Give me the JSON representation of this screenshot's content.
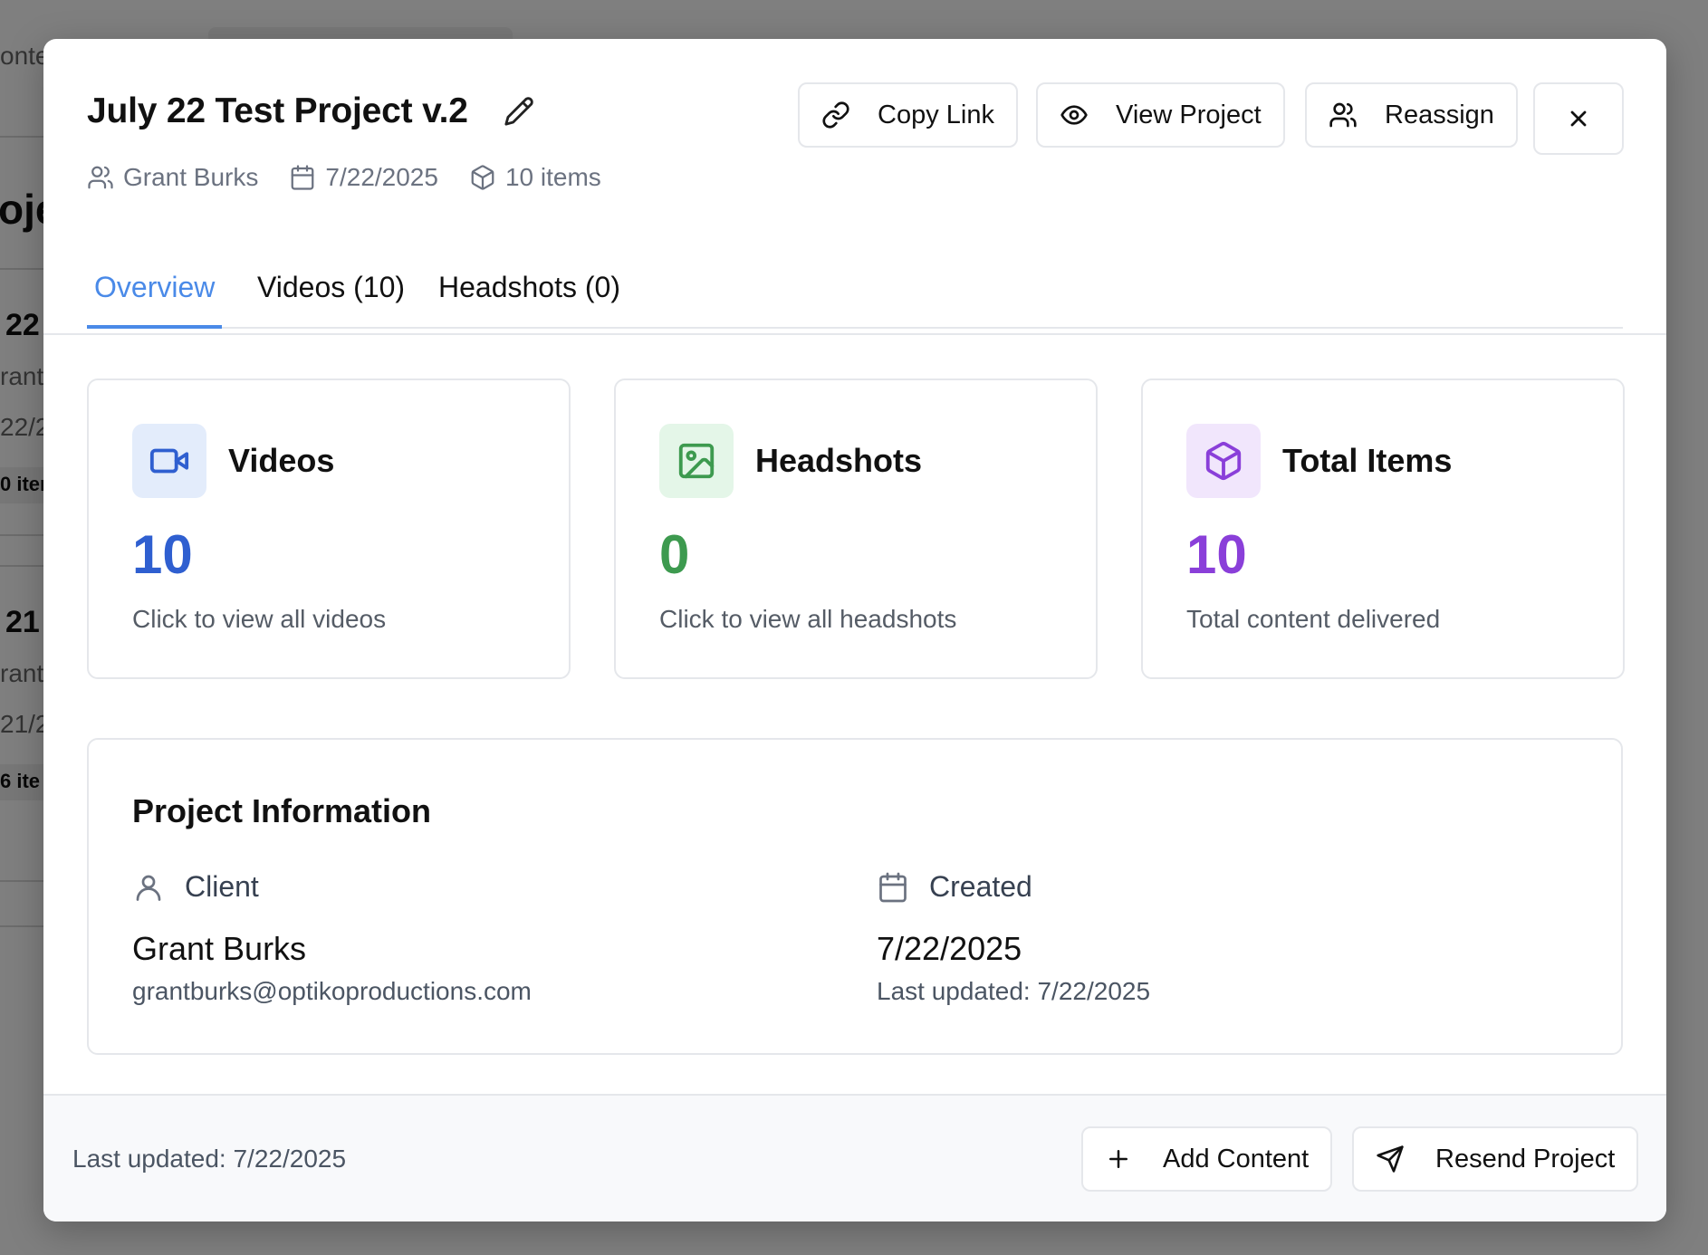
{
  "background": {
    "fragments": [
      "onte",
      "oje",
      "22",
      "rant",
      "22/2",
      "0 iter",
      "21",
      "rant",
      "21/2",
      "6 ite"
    ]
  },
  "modal": {
    "title": "July 22 Test Project v.2",
    "meta": {
      "client": "Grant Burks",
      "date": "7/22/2025",
      "items": "10 items"
    },
    "actions": {
      "copy_link": "Copy Link",
      "view_project": "View Project",
      "reassign": "Reassign"
    },
    "tabs": [
      {
        "label": "Overview",
        "active": true
      },
      {
        "label": "Videos (10)",
        "active": false
      },
      {
        "label": "Headshots (0)",
        "active": false
      }
    ],
    "cards": [
      {
        "title": "Videos",
        "value": "10",
        "subtitle": "Click to view all videos",
        "icon": "video-icon",
        "color": "#2f5fd0",
        "icon_bg": "#e3ecfb"
      },
      {
        "title": "Headshots",
        "value": "0",
        "subtitle": "Click to view all headshots",
        "icon": "image-icon",
        "color": "#3d9a4f",
        "icon_bg": "#e4f6e8"
      },
      {
        "title": "Total Items",
        "value": "10",
        "subtitle": "Total content delivered",
        "icon": "package-icon",
        "color": "#8a3fd9",
        "icon_bg": "#f1e6fc"
      }
    ],
    "project_info": {
      "title": "Project Information",
      "client_label": "Client",
      "client_name": "Grant Burks",
      "client_email": "grantburks@optikoproductions.com",
      "created_label": "Created",
      "created_date": "7/22/2025",
      "last_updated": "Last updated: 7/22/2025"
    },
    "footer": {
      "last_updated": "Last updated: 7/22/2025",
      "add_content": "Add Content",
      "resend_project": "Resend Project"
    }
  }
}
